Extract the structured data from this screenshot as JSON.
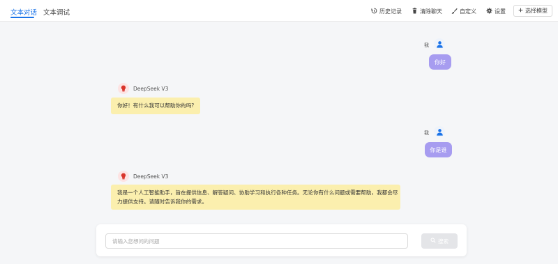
{
  "tabs": [
    {
      "label": "文本对话",
      "active": true
    },
    {
      "label": "文本调试",
      "active": false
    }
  ],
  "toolbar": {
    "history": {
      "label": "历史记录",
      "icon": "history-icon"
    },
    "clear": {
      "label": "清除聊天",
      "icon": "trash-icon"
    },
    "customize": {
      "label": "自定义",
      "icon": "brush-icon"
    },
    "settings": {
      "label": "设置",
      "icon": "gear-icon"
    },
    "select_model": {
      "label": "选择模型",
      "icon": "plus-icon"
    }
  },
  "messages": [
    {
      "role": "user",
      "sender": "我",
      "text": "你好"
    },
    {
      "role": "assistant",
      "sender": "DeepSeek V3",
      "lines": [
        "你好！有什么我可以帮助你的吗?"
      ]
    },
    {
      "role": "user",
      "sender": "我",
      "text": "你是谁"
    },
    {
      "role": "assistant",
      "sender": "DeepSeek V3",
      "lines": [
        "我是一个人工智能助手，旨在提供信息、解答疑问、协助学习和执行各种任务。无论你有什么问题或需要帮助，我都会尽",
        "力提供支持。请随时告诉我你的需求。"
      ]
    }
  ],
  "input": {
    "placeholder": "请输入您想问的问题",
    "value": "",
    "submit_label": "搜索"
  },
  "colors": {
    "accent": "#1a73e8",
    "user_bubble": "#a79cf0",
    "assistant_bubble": "#fbefae"
  }
}
